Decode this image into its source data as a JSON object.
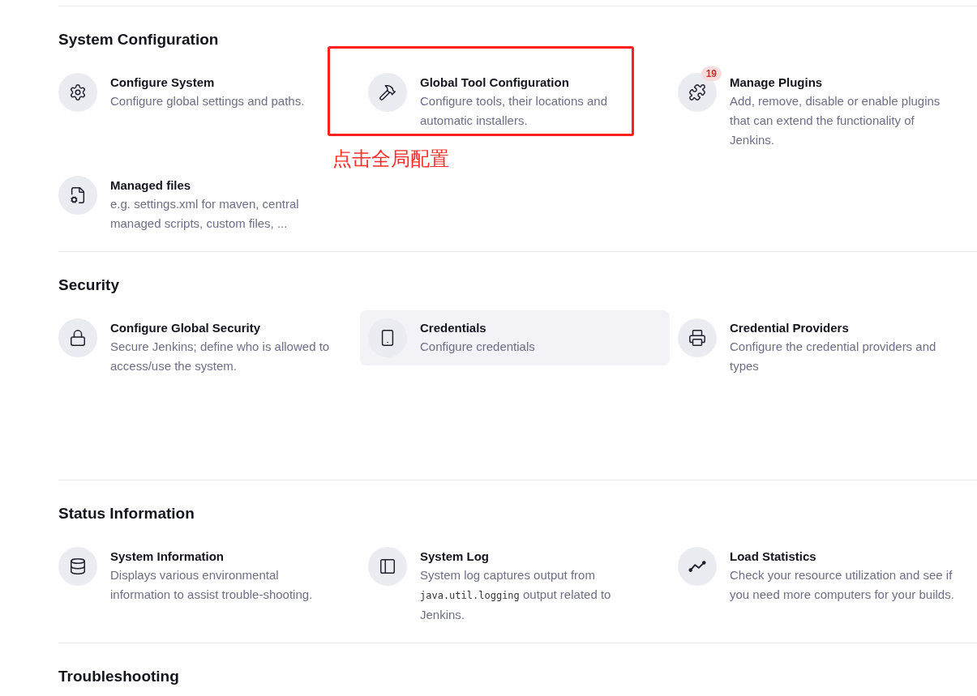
{
  "sections": [
    {
      "title": "System Configuration",
      "items": [
        {
          "title": "Configure System",
          "description": "Configure global settings and paths.",
          "highlighted": false
        },
        {
          "title": "Global Tool Configuration",
          "description": "Configure tools, their locations and automatic installers.",
          "highlighted": false,
          "annotation": "点击全局配置"
        },
        {
          "title": "Manage Plugins",
          "description": "Add, remove, disable or enable plugins that can extend the functionality of Jenkins.",
          "highlighted": false,
          "badge": "19"
        },
        {
          "title": "Managed files",
          "description": "e.g. settings.xml for maven, central managed scripts, custom files, ...",
          "highlighted": false
        }
      ]
    },
    {
      "title": "Security",
      "items": [
        {
          "title": "Configure Global Security",
          "description": "Secure Jenkins; define who is allowed to access/use the system.",
          "highlighted": false
        },
        {
          "title": "Credentials",
          "description": "Configure credentials",
          "highlighted": true
        },
        {
          "title": "Credential Providers",
          "description": "Configure the credential providers and types",
          "highlighted": false
        }
      ]
    },
    {
      "title": "Status Information",
      "items": [
        {
          "title": "System Information",
          "description": "Displays various environmental information to assist trouble-shooting.",
          "highlighted": false
        },
        {
          "title": "System Log",
          "description_parts": [
            {
              "kind": "text",
              "text": "System log captures output from "
            },
            {
              "kind": "code",
              "text": "java.util.logging"
            },
            {
              "kind": "text",
              "text": " output related to Jenkins."
            }
          ],
          "highlighted": false
        },
        {
          "title": "Load Statistics",
          "description": "Check your resource utilization and see if you need more computers for your builds.",
          "highlighted": false
        }
      ]
    },
    {
      "title": "Troubleshooting"
    }
  ]
}
